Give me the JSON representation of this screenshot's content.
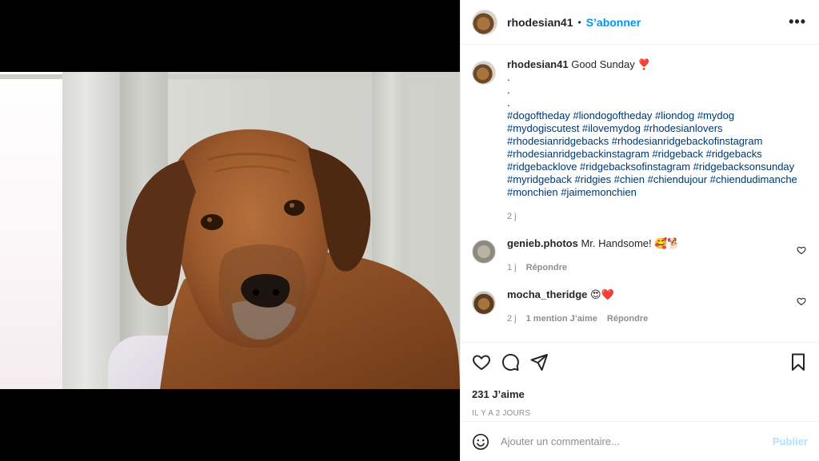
{
  "header": {
    "username": "rhodesian41",
    "separator": "•",
    "follow_label": "S’abonner",
    "more_label": "•••"
  },
  "caption": {
    "username": "rhodesian41",
    "text": "Good Sunday ❣️",
    "dots": [
      ".",
      ".",
      "."
    ],
    "hashtags": "#dogoftheday #liondogoftheday #liondog #mydog #mydogiscutest #ilovemydog #rhodesianlovers #rhodesianridgebacks #rhodesianridgebackofinstagram #rhodesianridgebackinstagram #ridgeback #ridgebacks #ridgebacklove #ridgebacksofinstagram #ridgebacksonsunday #myridgeback #ridgies #chien #chiendujour #chiendudimanche #monchien #jaimemonchien",
    "time": "2 j"
  },
  "comments": [
    {
      "username": "genieb.photos",
      "text": "Mr. Handsome! 🥰🐕",
      "time": "1 j",
      "likes_label": "",
      "reply_label": "Répondre"
    },
    {
      "username": "mocha_theridge",
      "text": "😍❤️",
      "time": "2 j",
      "likes_label": "1 mention J’aime",
      "reply_label": "Répondre"
    }
  ],
  "actions": {
    "icons": [
      "heart-icon",
      "comment-icon",
      "share-icon",
      "bookmark-icon"
    ],
    "likes": "231 J’aime",
    "posted_ago": "IL Y A 2 JOURS"
  },
  "add_comment": {
    "placeholder": "Ajouter un commentaire...",
    "publish_label": "Publier"
  },
  "colors": {
    "link_blue": "#0095f6",
    "hashtag_blue": "#00376b",
    "publish_disabled": "#b2dffc",
    "muted_text": "#8e8e8e"
  }
}
